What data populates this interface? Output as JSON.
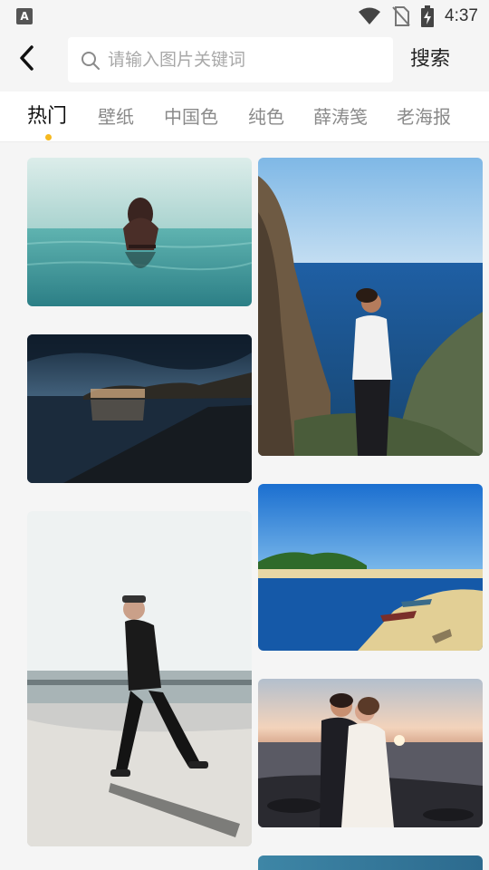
{
  "status_bar": {
    "time": "4:37",
    "app_badge": "A",
    "icons": [
      "notification-a-icon",
      "wifi-icon",
      "no-sim-icon",
      "battery-charging-icon"
    ]
  },
  "header": {
    "back_icon": "back-arrow-icon",
    "search_icon": "search-icon",
    "search_placeholder": "请输入图片关键词",
    "search_value": "",
    "search_button": "搜索"
  },
  "tabs": [
    {
      "label": "热门",
      "active": true
    },
    {
      "label": "壁纸",
      "active": false
    },
    {
      "label": "中国色",
      "active": false
    },
    {
      "label": "纯色",
      "active": false
    },
    {
      "label": "薛涛笺",
      "active": false
    },
    {
      "label": "老海报",
      "active": false
    }
  ],
  "accent_color": "#f6b920",
  "photos": [
    {
      "subject": "woman-in-sea"
    },
    {
      "subject": "woman-on-cliff"
    },
    {
      "subject": "village-by-lake"
    },
    {
      "subject": "beach-lagoon"
    },
    {
      "subject": "man-walking"
    },
    {
      "subject": "couple-at-sunset"
    },
    {
      "subject": "sea-partial"
    }
  ]
}
